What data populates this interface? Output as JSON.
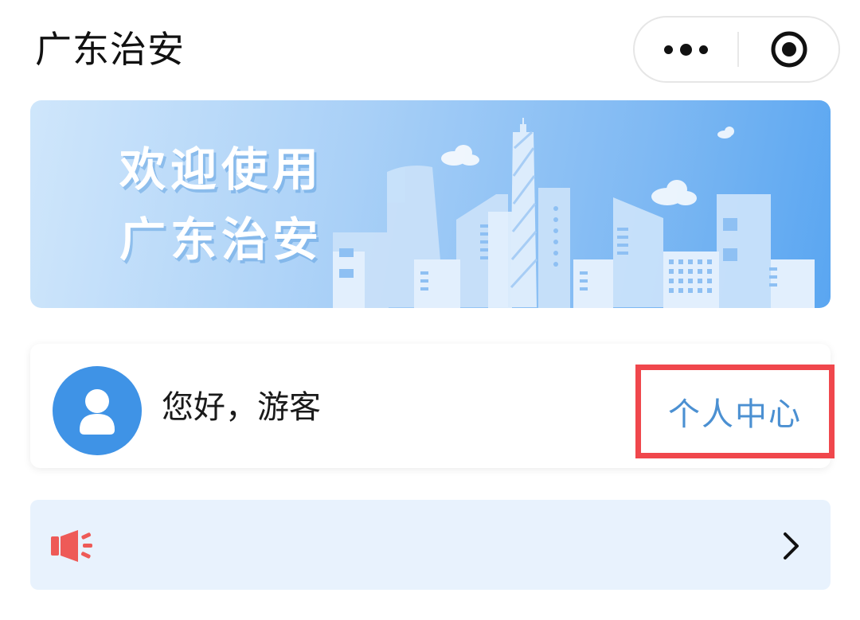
{
  "header": {
    "title": "广东治安",
    "more_icon": "more-dots-icon",
    "close_icon": "target-close-icon"
  },
  "banner": {
    "line1": "欢迎使用",
    "line2": "广东治安",
    "illustration": "city-skyline-illustration"
  },
  "user_card": {
    "avatar_icon": "user-avatar-icon",
    "greeting": "您好，游客",
    "personal_center_label": "个人中心",
    "highlight_color": "#f0474c"
  },
  "notice": {
    "icon": "megaphone-icon",
    "chevron": "chevron-right-icon",
    "text": ""
  },
  "colors": {
    "accent": "#3f93e6",
    "link": "#4b90d2",
    "notice_bg": "#e8f2fd",
    "megaphone": "#ee5a57"
  }
}
